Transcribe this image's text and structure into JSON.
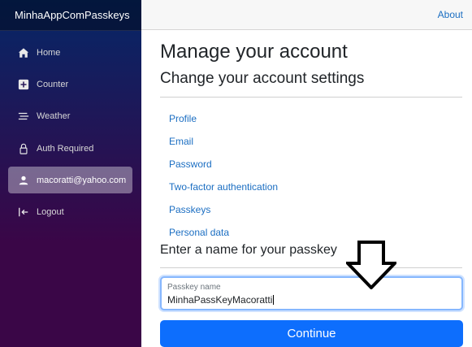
{
  "sidebar": {
    "brand": "MinhaAppComPasskeys",
    "items": [
      {
        "label": "Home",
        "icon": "house-icon"
      },
      {
        "label": "Counter",
        "icon": "plus-square-icon"
      },
      {
        "label": "Weather",
        "icon": "list-icon"
      },
      {
        "label": "Auth Required",
        "icon": "lock-icon"
      },
      {
        "label": "macoratti@yahoo.com",
        "icon": "person-icon",
        "active": true
      },
      {
        "label": "Logout",
        "icon": "logout-icon"
      }
    ]
  },
  "topbar": {
    "about": "About"
  },
  "main": {
    "title": "Manage your account",
    "subtitle": "Change your account settings",
    "links": [
      "Profile",
      "Email",
      "Password",
      "Two-factor authentication",
      "Passkeys",
      "Personal data"
    ],
    "passkey_heading": "Enter a name for your passkey",
    "input_label": "Passkey name",
    "input_value": "MinhaPassKeyMacoratti",
    "continue_label": "Continue"
  },
  "colors": {
    "link": "#1b6ec2",
    "primary_button": "#0d6efd",
    "sidebar_top": "#052767",
    "sidebar_bottom": "#3a0647"
  }
}
